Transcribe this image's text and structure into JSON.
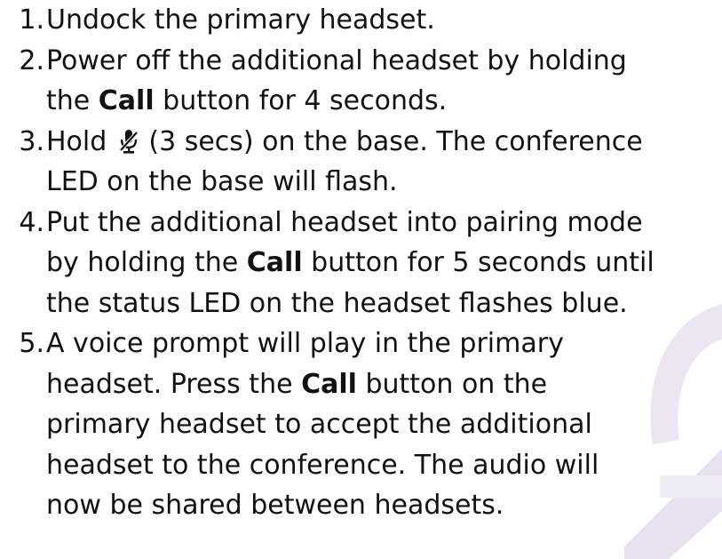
{
  "steps": [
    {
      "number": "1.",
      "lines": [
        [
          {
            "t": "Undock the primary headset."
          }
        ]
      ]
    },
    {
      "number": "2.",
      "lines": [
        [
          {
            "t": "Power off the additional headset by holding"
          }
        ],
        [
          {
            "t": "the "
          },
          {
            "t": "Call",
            "b": true
          },
          {
            "t": " button for 4 seconds."
          }
        ]
      ]
    },
    {
      "number": "3.",
      "lines": [
        [
          {
            "t": "Hold "
          },
          {
            "icon": "mic-mute-icon"
          },
          {
            "t": " (3 secs) on the base. The conference"
          }
        ],
        [
          {
            "t": "LED on the base will flash."
          }
        ]
      ]
    },
    {
      "number": "4.",
      "lines": [
        [
          {
            "t": "Put the additional headset into pairing mode"
          }
        ],
        [
          {
            "t": "by holding the "
          },
          {
            "t": "Call",
            "b": true
          },
          {
            "t": " button for 5 seconds until"
          }
        ],
        [
          {
            "t": "the status LED on the headset flashes blue."
          }
        ]
      ]
    },
    {
      "number": "5.",
      "lines": [
        [
          {
            "t": "A voice prompt will play in the primary"
          }
        ],
        [
          {
            "t": "headset. Press the "
          },
          {
            "t": "Call",
            "b": true
          },
          {
            "t": " button on the"
          }
        ],
        [
          {
            "t": "primary headset to accept the additional"
          }
        ],
        [
          {
            "t": "headset to the conference. The audio will"
          }
        ],
        [
          {
            "t": "now be shared between headsets."
          }
        ]
      ]
    }
  ],
  "colors": {
    "text": "#111111",
    "watermark": "#e9e4f1"
  }
}
